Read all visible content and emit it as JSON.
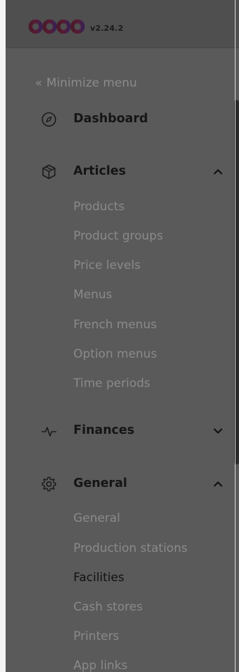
{
  "header": {
    "version": "v2.24.2",
    "logo_icon": "booq-logo"
  },
  "minimize": {
    "chevron": "«",
    "label": "Minimize menu"
  },
  "sections": {
    "dashboard": {
      "label": "Dashboard",
      "icon": "compass-icon"
    },
    "articles": {
      "label": "Articles",
      "icon": "cube-icon",
      "expanded": true,
      "items": [
        "Products",
        "Product groups",
        "Price levels",
        "Menus",
        "French menus",
        "Option menus",
        "Time periods"
      ]
    },
    "finances": {
      "label": "Finances",
      "icon": "activity-icon",
      "expanded": false
    },
    "general": {
      "label": "General",
      "icon": "gear-icon",
      "expanded": true,
      "items": [
        "General",
        "Production stations",
        "Facilities",
        "Cash stores",
        "Printers",
        "App links"
      ],
      "active_item": "Facilities"
    }
  },
  "colors": {
    "overlay": "#5a5a5a",
    "text_active": "#151515",
    "text_muted": "#8a8a8a"
  }
}
